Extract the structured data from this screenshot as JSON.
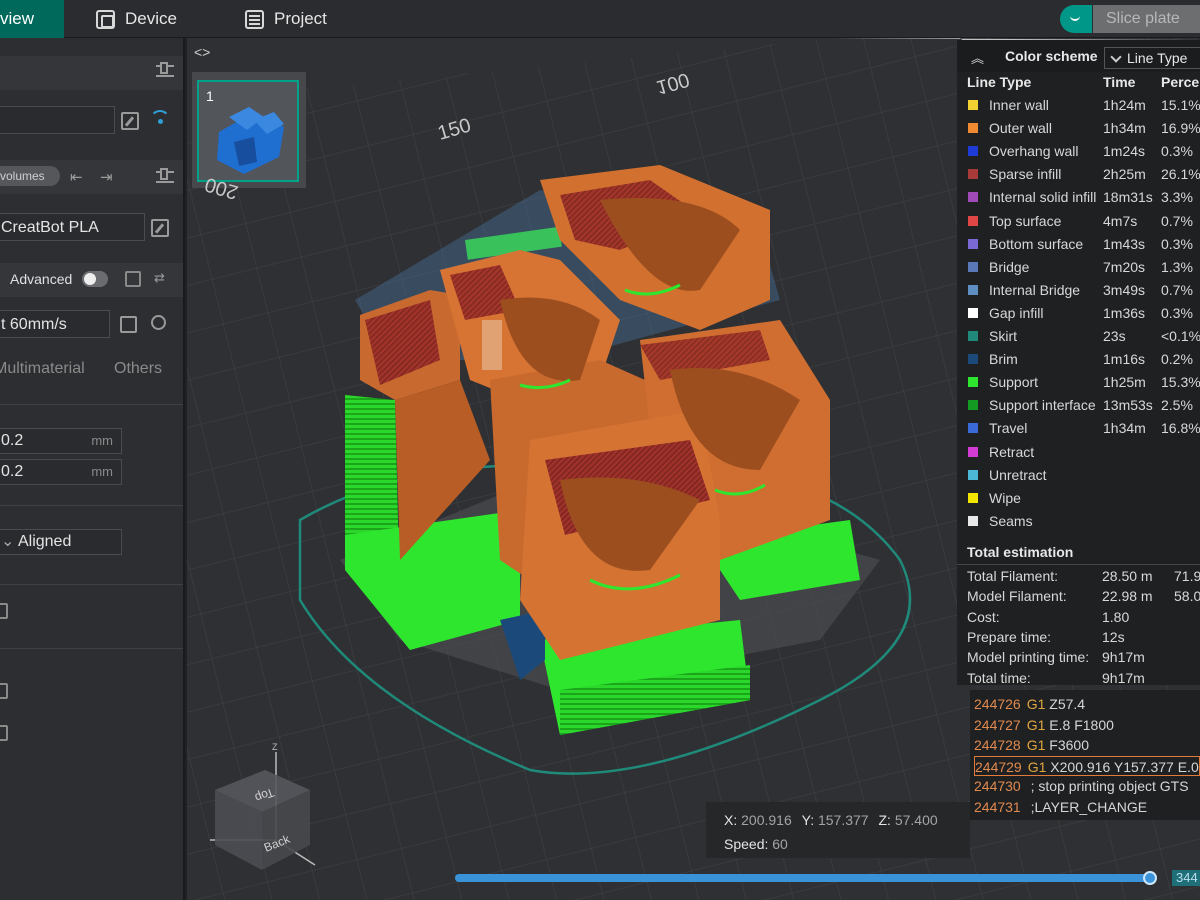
{
  "topbar": {
    "tabs": [
      {
        "label": "view"
      },
      {
        "label": "Device",
        "icon": "device-icon"
      },
      {
        "label": "Project",
        "icon": "project-icon"
      }
    ],
    "slice_label": "Slice plate",
    "accent": "#009688"
  },
  "sidebar": {
    "objects_volumes_label": "volumes",
    "filament_value": "CreatBot PLA",
    "advanced_label": "Advanced",
    "preset_value": "t 60mm/s",
    "tabs": [
      "Multimaterial",
      "Others"
    ],
    "layer_height_1": "0.2",
    "layer_height_2": "0.2",
    "unit": "mm",
    "seam_value": "Aligned"
  },
  "plate": {
    "number": "1",
    "axis_labels": [
      "150",
      "100",
      "200"
    ]
  },
  "legend": {
    "color_scheme_label": "Color scheme",
    "scheme_value": "Line Type",
    "columns": [
      "Line Type",
      "Time",
      "Perce"
    ],
    "rows": [
      {
        "name": "Inner wall",
        "time": "1h24m",
        "pct": "15.1%",
        "color": "#f2d233"
      },
      {
        "name": "Outer wall",
        "time": "1h34m",
        "pct": "16.9%",
        "color": "#f08a32"
      },
      {
        "name": "Overhang wall",
        "time": "1m24s",
        "pct": "0.3%",
        "color": "#1f3bd6"
      },
      {
        "name": "Sparse infill",
        "time": "2h25m",
        "pct": "26.1%",
        "color": "#a83a3a"
      },
      {
        "name": "Internal solid infill",
        "time": "18m31s",
        "pct": "3.3%",
        "color": "#a04ab8"
      },
      {
        "name": "Top surface",
        "time": "4m7s",
        "pct": "0.7%",
        "color": "#e04646"
      },
      {
        "name": "Bottom surface",
        "time": "1m43s",
        "pct": "0.3%",
        "color": "#7b6ad6"
      },
      {
        "name": "Bridge",
        "time": "7m20s",
        "pct": "1.3%",
        "color": "#5a78b8"
      },
      {
        "name": "Internal Bridge",
        "time": "3m49s",
        "pct": "0.7%",
        "color": "#5e8ec2"
      },
      {
        "name": "Gap infill",
        "time": "1m36s",
        "pct": "0.3%",
        "color": "#ffffff"
      },
      {
        "name": "Skirt",
        "time": "23s",
        "pct": "<0.1%",
        "color": "#1f8a7a"
      },
      {
        "name": "Brim",
        "time": "1m16s",
        "pct": "0.2%",
        "color": "#1b4a7a"
      },
      {
        "name": "Support",
        "time": "1h25m",
        "pct": "15.3%",
        "color": "#2ee62e"
      },
      {
        "name": "Support interface",
        "time": "13m53s",
        "pct": "2.5%",
        "color": "#129a22"
      },
      {
        "name": "Travel",
        "time": "1h34m",
        "pct": "16.8%",
        "color": "#3a6ad8"
      },
      {
        "name": "Retract",
        "time": "",
        "pct": "",
        "color": "#d43ad4"
      },
      {
        "name": "Unretract",
        "time": "",
        "pct": "",
        "color": "#4ab8d6"
      },
      {
        "name": "Wipe",
        "time": "",
        "pct": "",
        "color": "#f2e600"
      },
      {
        "name": "Seams",
        "time": "",
        "pct": "",
        "color": "#e8e8e8"
      }
    ],
    "total_title": "Total estimation",
    "totals": [
      {
        "label": "Total Filament:",
        "value": "28.50 m",
        "value2": "71.9"
      },
      {
        "label": "Model Filament:",
        "value": "22.98 m",
        "value2": "58.05"
      },
      {
        "label": "Cost:",
        "value": "1.80",
        "value2": ""
      },
      {
        "label": "Prepare time:",
        "value": "12s",
        "value2": ""
      },
      {
        "label": "Model printing time:",
        "value": "9h17m",
        "value2": ""
      },
      {
        "label": "Total time:",
        "value": "9h17m",
        "value2": ""
      }
    ]
  },
  "gcode": [
    {
      "num": "244726",
      "g": "G1",
      "rest": " Z57.4"
    },
    {
      "num": "244727",
      "g": "G1",
      "rest": " E.8 F1800"
    },
    {
      "num": "244728",
      "g": "G1",
      "rest": " F3600"
    },
    {
      "num": "244729",
      "g": "G1",
      "rest": " X200.916 Y157.377 E.0"
    },
    {
      "num": "244730",
      "g": "",
      "rest": " ; stop printing object GTS"
    },
    {
      "num": "244731",
      "g": "",
      "rest": " ;LAYER_CHANGE"
    }
  ],
  "coords": {
    "x_label": "X:",
    "x": "200.916",
    "y_label": "Y:",
    "y": "157.377",
    "z_label": "Z:",
    "z": "57.400",
    "speed_label": "Speed:",
    "speed": "60"
  },
  "nav_cube": {
    "top": "Top",
    "back": "Back",
    "axis_z": "Z"
  },
  "slider": {
    "progress": 0.99,
    "layer_value": "344"
  }
}
